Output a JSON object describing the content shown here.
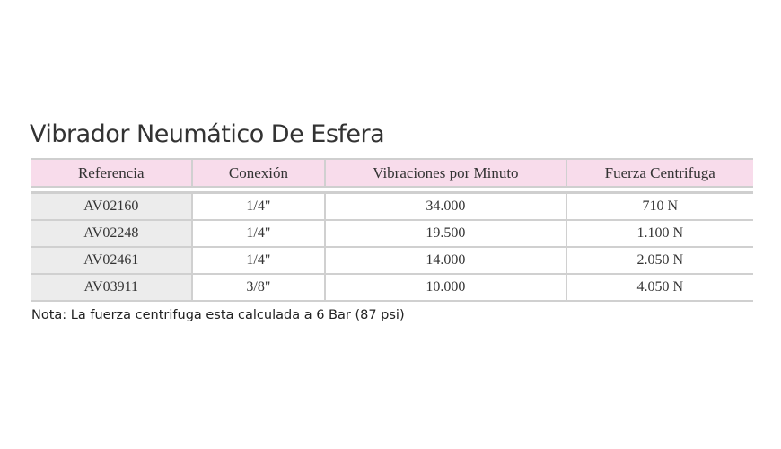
{
  "title": "Vibrador Neumático De Esfera",
  "table": {
    "headers": [
      "Referencia",
      "Conexión",
      "Vibraciones por Minuto",
      "Fuerza Centrifuga"
    ],
    "rows": [
      [
        "AV02160",
        "1/4\"",
        "34.000",
        "710 N"
      ],
      [
        "AV02248",
        "1/4\"",
        "19.500",
        "1.100 N"
      ],
      [
        "AV02461",
        "1/4\"",
        "14.000",
        "2.050 N"
      ],
      [
        "AV03911",
        "3/8\"",
        "10.000",
        "4.050 N"
      ]
    ]
  },
  "note": "Nota: La fuerza centrifuga esta calculada a 6 Bar (87 psi)",
  "colors": {
    "header_bg": "#f8dceb",
    "first_col_bg": "#ececec",
    "border": "#cfcfcf"
  }
}
